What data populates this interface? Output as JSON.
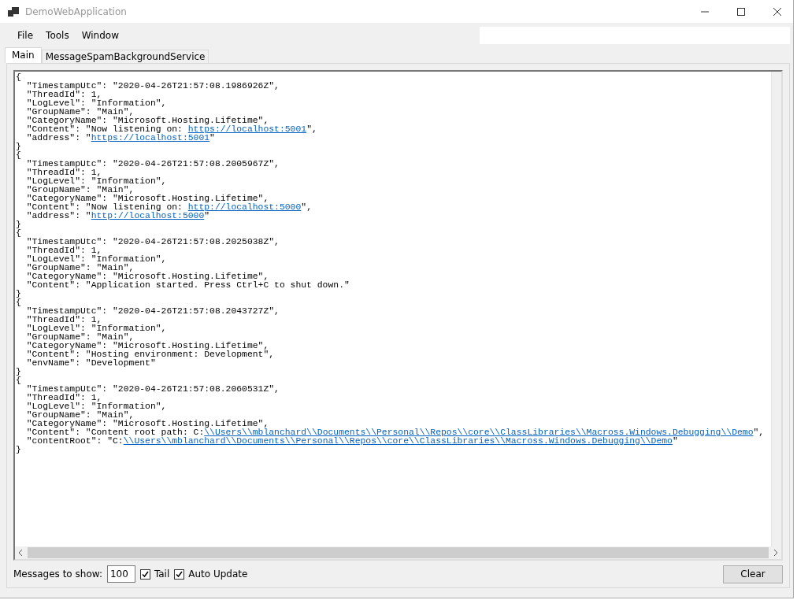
{
  "window": {
    "title": "DemoWebApplication"
  },
  "menu": [
    "File",
    "Tools",
    "Window"
  ],
  "tabs": [
    {
      "label": "Main",
      "selected": true
    },
    {
      "label": "MessageSpamBackgroundService",
      "selected": false
    }
  ],
  "log_lines": [
    [
      {
        "kind": "text",
        "text": "{"
      }
    ],
    [
      {
        "kind": "text",
        "text": "  \"TimestampUtc\": \"2020-04-26T21:57:08.1986926Z\","
      }
    ],
    [
      {
        "kind": "text",
        "text": "  \"ThreadId\": 1,"
      }
    ],
    [
      {
        "kind": "text",
        "text": "  \"LogLevel\": \"Information\","
      }
    ],
    [
      {
        "kind": "text",
        "text": "  \"GroupName\": \"Main\","
      }
    ],
    [
      {
        "kind": "text",
        "text": "  \"CategoryName\": \"Microsoft.Hosting.Lifetime\","
      }
    ],
    [
      {
        "kind": "text",
        "text": "  \"Content\": \"Now listening on: "
      },
      {
        "kind": "link",
        "text": "https://localhost:5001"
      },
      {
        "kind": "text",
        "text": "\","
      }
    ],
    [
      {
        "kind": "text",
        "text": "  \"address\": \""
      },
      {
        "kind": "link",
        "text": "https://localhost:5001"
      },
      {
        "kind": "text",
        "text": "\""
      }
    ],
    [
      {
        "kind": "text",
        "text": "}"
      }
    ],
    [
      {
        "kind": "text",
        "text": "{"
      }
    ],
    [
      {
        "kind": "text",
        "text": "  \"TimestampUtc\": \"2020-04-26T21:57:08.2005967Z\","
      }
    ],
    [
      {
        "kind": "text",
        "text": "  \"ThreadId\": 1,"
      }
    ],
    [
      {
        "kind": "text",
        "text": "  \"LogLevel\": \"Information\","
      }
    ],
    [
      {
        "kind": "text",
        "text": "  \"GroupName\": \"Main\","
      }
    ],
    [
      {
        "kind": "text",
        "text": "  \"CategoryName\": \"Microsoft.Hosting.Lifetime\","
      }
    ],
    [
      {
        "kind": "text",
        "text": "  \"Content\": \"Now listening on: "
      },
      {
        "kind": "link",
        "text": "http://localhost:5000"
      },
      {
        "kind": "text",
        "text": "\","
      }
    ],
    [
      {
        "kind": "text",
        "text": "  \"address\": \""
      },
      {
        "kind": "link",
        "text": "http://localhost:5000"
      },
      {
        "kind": "text",
        "text": "\""
      }
    ],
    [
      {
        "kind": "text",
        "text": "}"
      }
    ],
    [
      {
        "kind": "text",
        "text": "{"
      }
    ],
    [
      {
        "kind": "text",
        "text": "  \"TimestampUtc\": \"2020-04-26T21:57:08.2025038Z\","
      }
    ],
    [
      {
        "kind": "text",
        "text": "  \"ThreadId\": 1,"
      }
    ],
    [
      {
        "kind": "text",
        "text": "  \"LogLevel\": \"Information\","
      }
    ],
    [
      {
        "kind": "text",
        "text": "  \"GroupName\": \"Main\","
      }
    ],
    [
      {
        "kind": "text",
        "text": "  \"CategoryName\": \"Microsoft.Hosting.Lifetime\","
      }
    ],
    [
      {
        "kind": "text",
        "text": "  \"Content\": \"Application started. Press Ctrl+C to shut down.\""
      }
    ],
    [
      {
        "kind": "text",
        "text": "}"
      }
    ],
    [
      {
        "kind": "text",
        "text": "{"
      }
    ],
    [
      {
        "kind": "text",
        "text": "  \"TimestampUtc\": \"2020-04-26T21:57:08.2043727Z\","
      }
    ],
    [
      {
        "kind": "text",
        "text": "  \"ThreadId\": 1,"
      }
    ],
    [
      {
        "kind": "text",
        "text": "  \"LogLevel\": \"Information\","
      }
    ],
    [
      {
        "kind": "text",
        "text": "  \"GroupName\": \"Main\","
      }
    ],
    [
      {
        "kind": "text",
        "text": "  \"CategoryName\": \"Microsoft.Hosting.Lifetime\","
      }
    ],
    [
      {
        "kind": "text",
        "text": "  \"Content\": \"Hosting environment: Development\","
      }
    ],
    [
      {
        "kind": "text",
        "text": "  \"envName\": \"Development\""
      }
    ],
    [
      {
        "kind": "text",
        "text": "}"
      }
    ],
    [
      {
        "kind": "text",
        "text": "{"
      }
    ],
    [
      {
        "kind": "text",
        "text": "  \"TimestampUtc\": \"2020-04-26T21:57:08.2060531Z\","
      }
    ],
    [
      {
        "kind": "text",
        "text": "  \"ThreadId\": 1,"
      }
    ],
    [
      {
        "kind": "text",
        "text": "  \"LogLevel\": \"Information\","
      }
    ],
    [
      {
        "kind": "text",
        "text": "  \"GroupName\": \"Main\","
      }
    ],
    [
      {
        "kind": "text",
        "text": "  \"CategoryName\": \"Microsoft.Hosting.Lifetime\","
      }
    ],
    [
      {
        "kind": "text",
        "text": "  \"Content\": \"Content root path: C:"
      },
      {
        "kind": "link",
        "text": "\\\\Users\\\\mblanchard\\\\Documents\\\\Personal\\\\Repos\\\\core\\\\ClassLibraries\\\\Macross.Windows.Debugging\\\\Demo"
      },
      {
        "kind": "text",
        "text": "\","
      }
    ],
    [
      {
        "kind": "text",
        "text": "  \"contentRoot\": \"C:"
      },
      {
        "kind": "link",
        "text": "\\\\Users\\\\mblanchard\\\\Documents\\\\Personal\\\\Repos\\\\core\\\\ClassLibraries\\\\Macross.Windows.Debugging\\\\Demo"
      },
      {
        "kind": "text",
        "text": "\""
      }
    ],
    [
      {
        "kind": "text",
        "text": "}"
      }
    ]
  ],
  "footer": {
    "messages_label": "Messages to show:",
    "messages_value": "100",
    "checkboxes": [
      {
        "label": "Tail",
        "checked": true
      },
      {
        "label": "Auto Update",
        "checked": true
      }
    ],
    "clear_button": "Clear"
  }
}
